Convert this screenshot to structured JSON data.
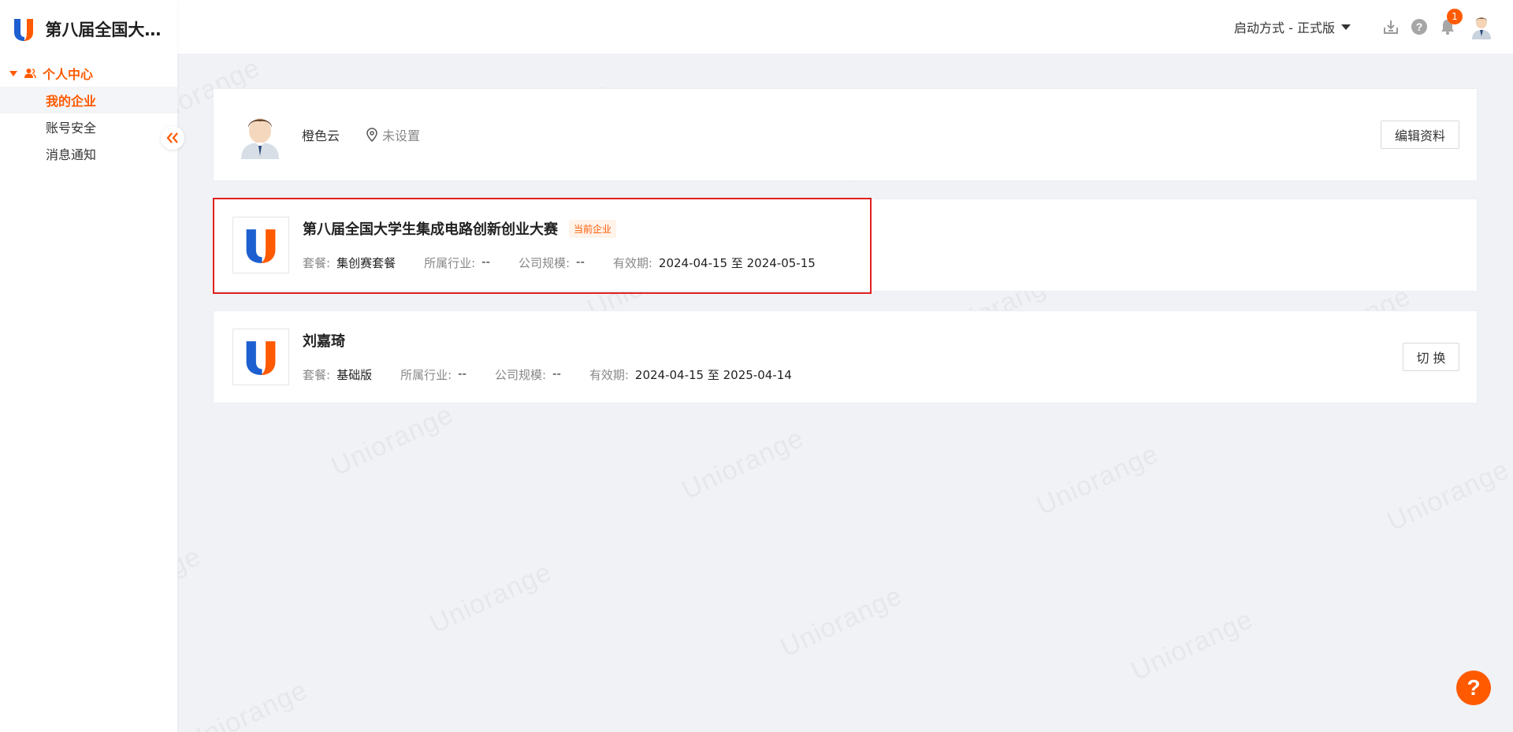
{
  "app": {
    "title": "第八届全国大学生集成电路创新创业大赛",
    "watermark": "Uniorange"
  },
  "colors": {
    "brand_orange": "#ff5a00",
    "brand_blue": "#1d5fd0",
    "highlight_red": "#e02020"
  },
  "sidebar": {
    "group_label": "个人中心",
    "items": [
      {
        "label": "我的企业",
        "active": true
      },
      {
        "label": "账号安全",
        "active": false
      },
      {
        "label": "消息通知",
        "active": false
      }
    ],
    "collapse_icon": "double-chevron-left-icon"
  },
  "header": {
    "launch_mode": "启动方式 - 正式版",
    "notification_count": "1",
    "icons": [
      "download-icon",
      "help-circle-icon",
      "bell-icon",
      "user-avatar"
    ]
  },
  "profile": {
    "name": "橙色云",
    "location": "未设置",
    "edit_button": "编辑资料"
  },
  "enterprises": [
    {
      "name": "第八届全国大学生集成电路创新创业大赛",
      "tag": "当前企业",
      "plan_label": "套餐:",
      "plan": "集创赛套餐",
      "industry_label": "所属行业:",
      "industry": "--",
      "scale_label": "公司规模:",
      "scale": "--",
      "validity_label": "有效期:",
      "validity": "2024-04-15 至 2024-05-15"
    },
    {
      "name": "刘嘉琦",
      "plan_label": "套餐:",
      "plan": "基础版",
      "industry_label": "所属行业:",
      "industry": "--",
      "scale_label": "公司规模:",
      "scale": "--",
      "validity_label": "有效期:",
      "validity": "2024-04-15 至 2025-04-14",
      "switch_button": "切 换"
    }
  ],
  "help_fab": "?"
}
